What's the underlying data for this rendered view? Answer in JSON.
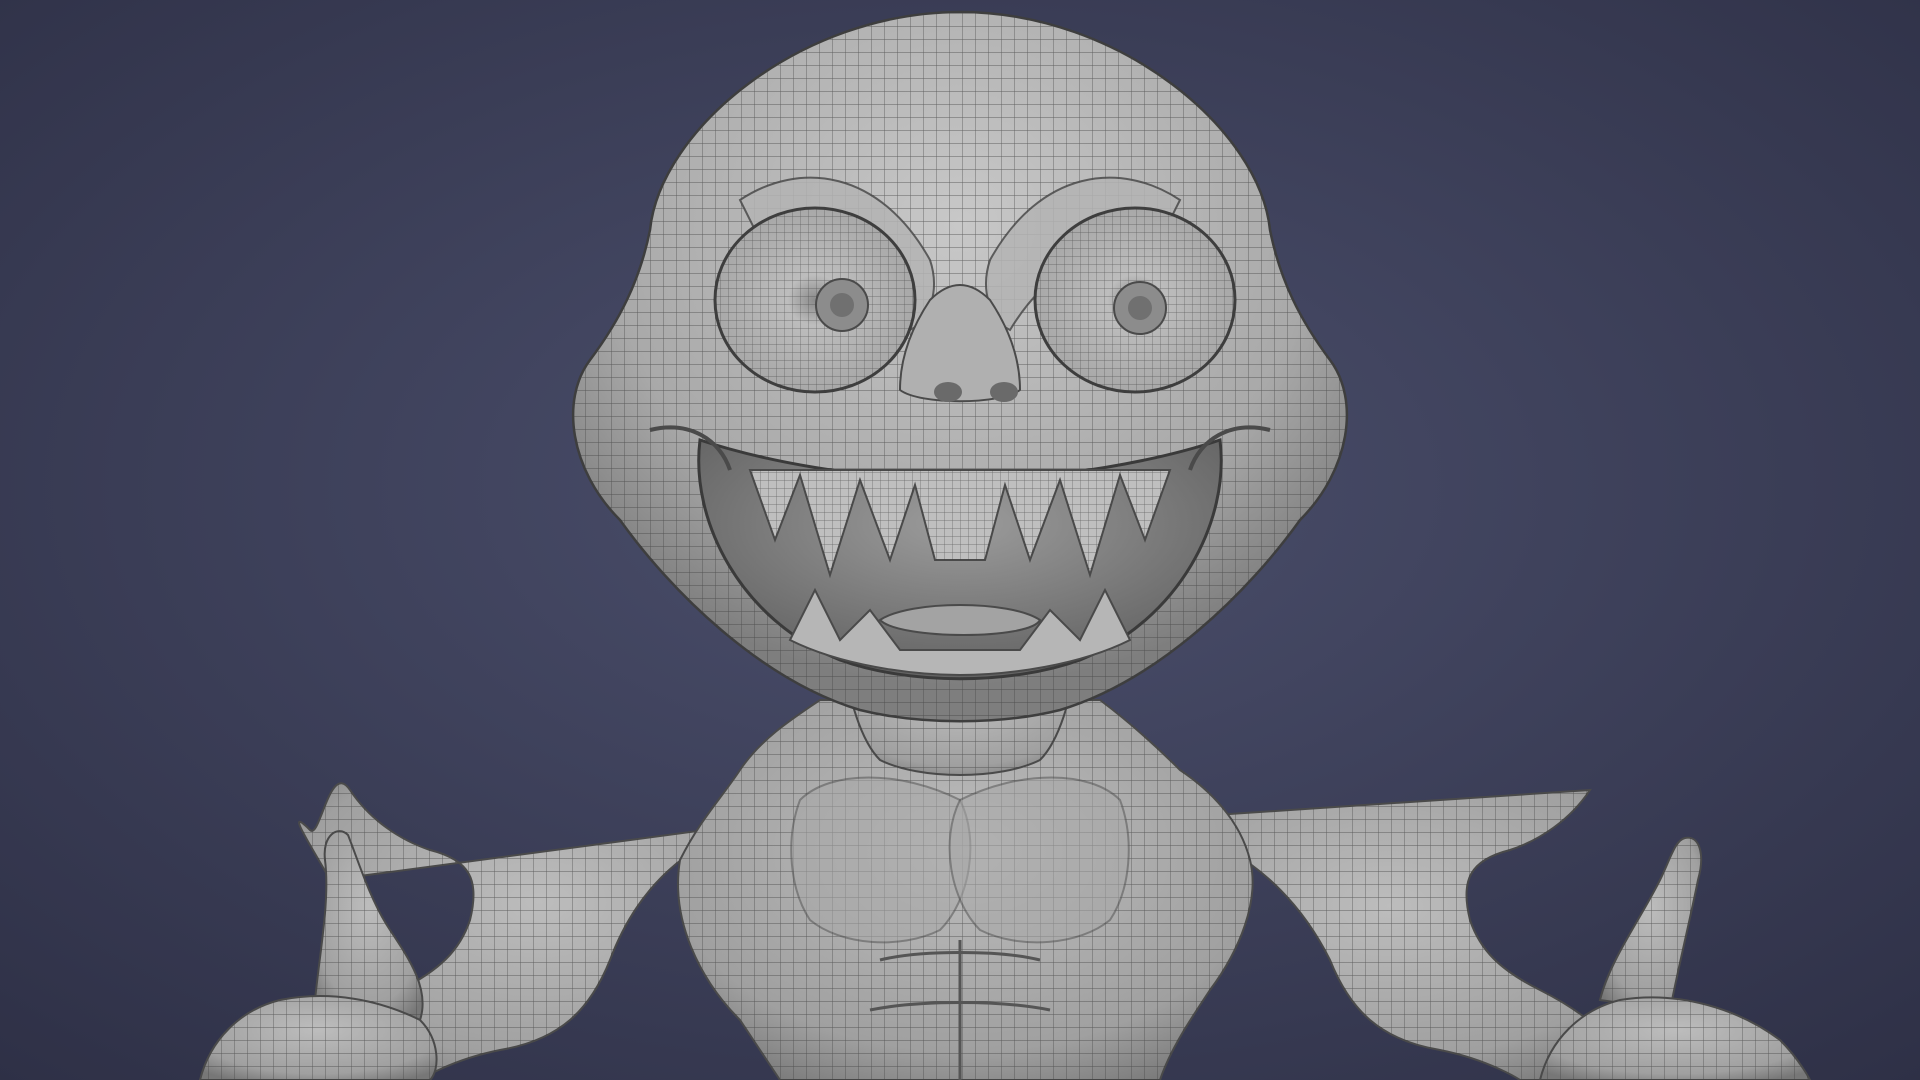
{
  "scene": {
    "subject": "creature-sculpt-wireframe",
    "colors": {
      "background_center": "#4b4f6c",
      "background_edge": "#2e3046",
      "skin_light": "#b9b9b9",
      "skin_mid": "#9a9a9a",
      "skin_dark": "#555555",
      "wire": "#3f3f3f",
      "mouth_interior": "#6e6e6e"
    }
  }
}
